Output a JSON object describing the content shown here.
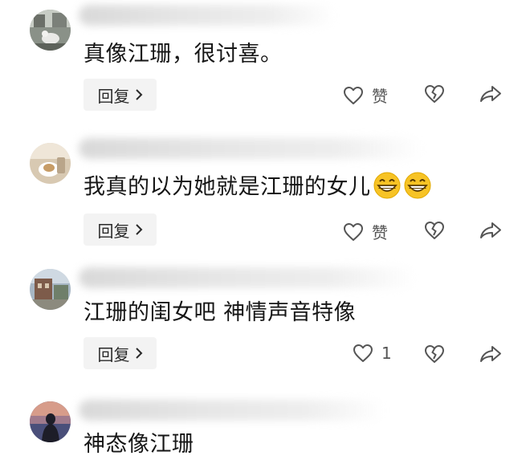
{
  "comments": [
    {
      "text": "真像江珊，很讨喜。",
      "reply_label": "回复",
      "like_label": "赞",
      "emoji": []
    },
    {
      "text": "我真的以为她就是江珊的女儿",
      "reply_label": "回复",
      "like_label": "赞",
      "emoji": [
        "grin-emoji",
        "grin-emoji"
      ]
    },
    {
      "text": "江珊的闺女吧 神情声音特像",
      "reply_label": "回复",
      "like_label": "1",
      "emoji": []
    },
    {
      "text": "神态像江珊",
      "reply_label": "",
      "like_label": "",
      "emoji": []
    }
  ],
  "icons": {
    "like": "heart-outline-icon",
    "dislike": "broken-heart-icon",
    "share": "share-arrow-icon",
    "reply_chevron": "chevron-right-icon"
  },
  "colors": {
    "reply_bg": "#f3f3f3",
    "icon_stroke": "#555555",
    "emoji_yellow": "#f7c325"
  }
}
